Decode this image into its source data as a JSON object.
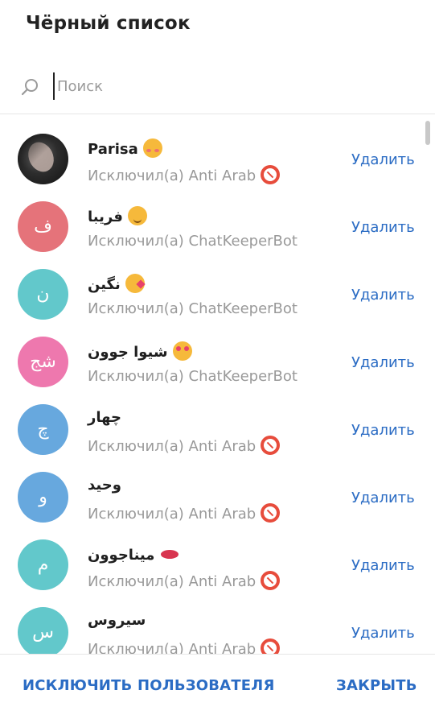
{
  "dialog": {
    "title": "Чёрный список",
    "search": {
      "placeholder": "Поиск",
      "value": ""
    },
    "remove_label": "Удалить",
    "footer": {
      "kick_label": "ИСКЛЮЧИТЬ ПОЛЬЗОВАТЕЛЯ",
      "close_label": "ЗАКРЫТЬ"
    }
  },
  "users": [
    {
      "name": "Parisa",
      "name_emoji": "smiling-face-with-hearts-icon",
      "initials": "",
      "avatar_color": "#2d2d2d",
      "avatar_photo": true,
      "sub": "Исключил(а) Anti Arab",
      "sub_icon": "no-entry-icon"
    },
    {
      "name": "فریبا",
      "name_emoji": "relieved-face-icon",
      "initials": "ف",
      "avatar_color": "#e5737a",
      "avatar_photo": false,
      "sub": "Исключил(а) ChatKeeperBot",
      "sub_icon": ""
    },
    {
      "name": "نگین",
      "name_emoji": "face-blowing-kiss-icon",
      "initials": "ن",
      "avatar_color": "#62c8cb",
      "avatar_photo": false,
      "sub": "Исключил(а) ChatKeeperBot",
      "sub_icon": ""
    },
    {
      "name": "شیوا جوون",
      "name_emoji": "heart-eyes-icon",
      "initials": "شج",
      "avatar_color": "#ee78ae",
      "avatar_photo": false,
      "sub": "Исключил(а) ChatKeeperBot",
      "sub_icon": ""
    },
    {
      "name": "چهار",
      "name_emoji": "",
      "initials": "چ",
      "avatar_color": "#67a8de",
      "avatar_photo": false,
      "sub": "Исключил(а) Anti Arab",
      "sub_icon": "no-entry-icon"
    },
    {
      "name": "وحید",
      "name_emoji": "",
      "initials": "و",
      "avatar_color": "#67a8de",
      "avatar_photo": false,
      "sub": "Исключил(а) Anti Arab",
      "sub_icon": "no-entry-icon"
    },
    {
      "name": "میناجوون",
      "name_emoji": "kiss-mark-icon",
      "initials": "م",
      "avatar_color": "#62c8cb",
      "avatar_photo": false,
      "sub": "Исключил(а) Anti Arab",
      "sub_icon": "no-entry-icon"
    },
    {
      "name": "سیروس",
      "name_emoji": "",
      "initials": "س",
      "avatar_color": "#62c8cb",
      "avatar_photo": false,
      "sub": "Исключил(а) Anti Arab",
      "sub_icon": "no-entry-icon"
    }
  ],
  "colors": {
    "accent": "#2b6cc4",
    "muted_text": "#999999",
    "no_entry_red": "#e74c3c"
  }
}
